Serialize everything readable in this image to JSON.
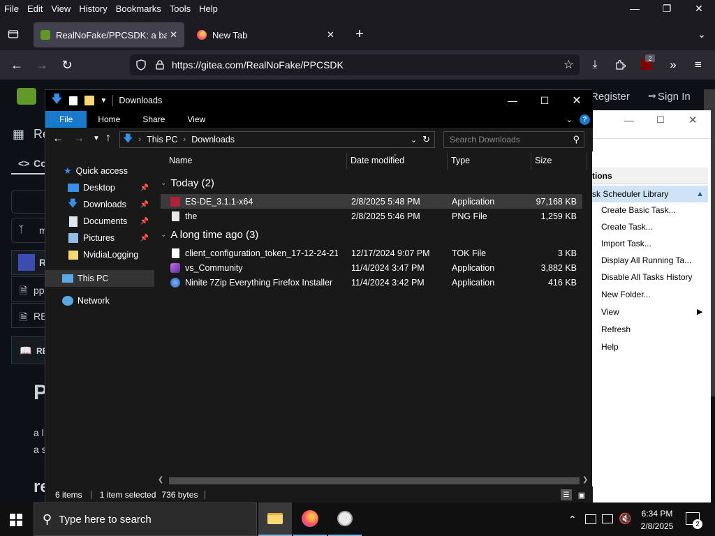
{
  "browser": {
    "menu": [
      "File",
      "Edit",
      "View",
      "History",
      "Bookmarks",
      "Tools",
      "Help"
    ],
    "tabs": [
      {
        "title": "RealNoFake/PPCSDK: a batch sc",
        "active": true
      },
      {
        "title": "New Tab",
        "active": false
      }
    ],
    "url": "https://gitea.com/RealNoFake/PPCSDK",
    "extension_badge": "2"
  },
  "page": {
    "register": "Register",
    "sign_in": "Sign In",
    "repo_letters": "Re",
    "code_tab": "Co",
    "branch_letter": "m",
    "file_row1": "pp",
    "file_row2": "RE",
    "readme_label": "RE",
    "heading_letter": "P",
    "desc_line1": "a l",
    "desc_line2": "a s",
    "heading2": "re"
  },
  "task_scheduler": {
    "section": "tions",
    "library": "sk Scheduler Library",
    "items": [
      "Create Basic Task...",
      "Create Task...",
      "Import Task...",
      "Display All Running Ta...",
      "Disable All Tasks History",
      "New Folder...",
      "View",
      "Refresh",
      "Help"
    ]
  },
  "explorer": {
    "title": "Downloads",
    "ribbon": {
      "file": "File",
      "home": "Home",
      "share": "Share",
      "view": "View"
    },
    "breadcrumb": [
      "This PC",
      "Downloads"
    ],
    "search_placeholder": "Search Downloads",
    "nav": {
      "quick_access": "Quick access",
      "items": [
        {
          "label": "Desktop",
          "pinned": true
        },
        {
          "label": "Downloads",
          "pinned": true
        },
        {
          "label": "Documents",
          "pinned": true
        },
        {
          "label": "Pictures",
          "pinned": true
        },
        {
          "label": "NvidiaLogging",
          "pinned": false
        }
      ],
      "this_pc": "This PC",
      "network": "Network"
    },
    "columns": {
      "name": "Name",
      "date": "Date modified",
      "type": "Type",
      "size": "Size"
    },
    "groups": [
      {
        "label": "Today (2)",
        "files": [
          {
            "name": "ES-DE_3.1.1-x64",
            "date": "2/8/2025 5:48 PM",
            "type": "Application",
            "size": "97,168 KB",
            "icon": "esde-icon",
            "selected": true
          },
          {
            "name": "the",
            "date": "2/8/2025 5:46 PM",
            "type": "PNG File",
            "size": "1,259 KB",
            "icon": "png-file-icon",
            "selected": false
          }
        ]
      },
      {
        "label": "A long time ago (3)",
        "files": [
          {
            "name": "client_configuration_token_17-12-24-21-...",
            "date": "12/17/2024 9:07 PM",
            "type": "TOK File",
            "size": "3 KB",
            "icon": "generic-file-icon",
            "selected": false
          },
          {
            "name": "vs_Community",
            "date": "11/4/2024 3:47 PM",
            "type": "Application",
            "size": "3,882 KB",
            "icon": "visual-studio-icon",
            "selected": false
          },
          {
            "name": "Ninite 7Zip Everything Firefox Installer",
            "date": "11/4/2024 3:42 PM",
            "type": "Application",
            "size": "416 KB",
            "icon": "ninite-icon",
            "selected": false
          }
        ]
      }
    ],
    "status": {
      "items": "6 items",
      "selected": "1 item selected",
      "size": "736 bytes"
    }
  },
  "taskbar": {
    "search_placeholder": "Type here to search",
    "time": "6:34 PM",
    "date": "2/8/2025",
    "notification_count": "2"
  },
  "colors": {
    "accent": "#1979ca",
    "selection": "#3b3b3b",
    "firefox_bg": "#1c1b22"
  }
}
